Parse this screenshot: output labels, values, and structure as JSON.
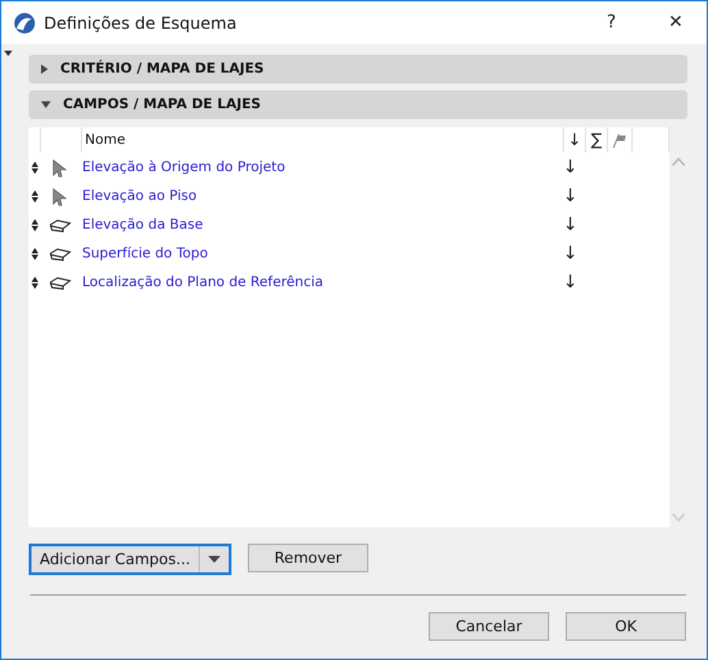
{
  "window": {
    "title": "Definições de Esquema",
    "help": "?",
    "close": "✕"
  },
  "sections": [
    {
      "label": "CRITÉRIO /  MAPA DE LAJES",
      "expanded": false
    },
    {
      "label": "CAMPOS /  MAPA DE LAJES",
      "expanded": true
    }
  ],
  "table": {
    "columns": {
      "name": "Nome",
      "sort": "↓",
      "sum": "∑"
    },
    "rows": [
      {
        "kind": "pointer",
        "name": "Elevação à Origem do Projeto",
        "sort": "↓"
      },
      {
        "kind": "pointer",
        "name": "Elevação ao Piso",
        "sort": "↓"
      },
      {
        "kind": "slab",
        "name": "Elevação da Base",
        "sort": "↓"
      },
      {
        "kind": "slab",
        "name": "Superfície do Topo",
        "sort": "↓"
      },
      {
        "kind": "slab",
        "name": "Localização do Plano de Referência",
        "sort": "↓"
      }
    ]
  },
  "buttons": {
    "add": "Adicionar Campos...",
    "remove": "Remover",
    "cancel": "Cancelar",
    "ok": "OK"
  }
}
